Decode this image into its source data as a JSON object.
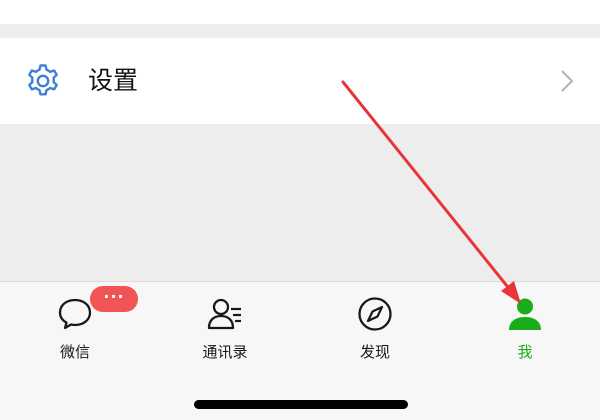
{
  "settings_row": {
    "icon": "gear-icon",
    "label": "设置",
    "chevron": "chevron-right-icon"
  },
  "tabbar": {
    "active_color": "#1aad19",
    "tabs": [
      {
        "label": "微信",
        "icon": "chat-bubble-icon",
        "badge": "···"
      },
      {
        "label": "通讯录",
        "icon": "contacts-icon"
      },
      {
        "label": "发现",
        "icon": "compass-icon"
      },
      {
        "label": "我",
        "icon": "person-icon",
        "active": true
      }
    ]
  },
  "annotation": {
    "type": "arrow",
    "color": "#e8353a",
    "points_to": "tab-me"
  }
}
